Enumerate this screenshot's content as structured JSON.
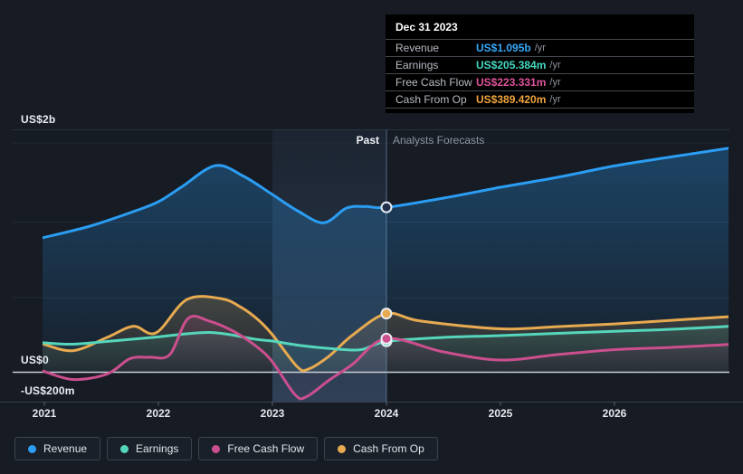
{
  "tooltip": {
    "title": "Dec 31 2023",
    "rows": [
      {
        "label": "Revenue",
        "value": "US$1.095b",
        "suffix": "/yr",
        "color": "#36a7f9"
      },
      {
        "label": "Earnings",
        "value": "US$205.384m",
        "suffix": "/yr",
        "color": "#45d9c2"
      },
      {
        "label": "Free Cash Flow",
        "value": "US$223.331m",
        "suffix": "/yr",
        "color": "#e0539d"
      },
      {
        "label": "Cash From Op",
        "value": "US$389.420m",
        "suffix": "/yr",
        "color": "#efa43d"
      }
    ]
  },
  "annotations": {
    "past": "Past",
    "forecast": "Analysts Forecasts"
  },
  "axes": {
    "y_labels": {
      "top": "US$2b",
      "zero": "US$0",
      "neg": "-US$200m"
    },
    "x_ticks": [
      "2021",
      "2022",
      "2023",
      "2024",
      "2025",
      "2026"
    ]
  },
  "legend": {
    "items": [
      {
        "label": "Revenue",
        "color": "#2b9df2"
      },
      {
        "label": "Earnings",
        "color": "#55d6bb"
      },
      {
        "label": "Free Cash Flow",
        "color": "#cb4f8e"
      },
      {
        "label": "Cash From Op",
        "color": "#e7aa50"
      }
    ]
  },
  "chart_data": {
    "type": "area",
    "title": "Past performance and analysts forecasts",
    "unit": "US$ millions per year",
    "x_domain": [
      2021,
      2027
    ],
    "x_tick_years": [
      2021,
      2022,
      2023,
      2024,
      2025,
      2026
    ],
    "y_axis": {
      "top_label": "US$2b",
      "zero_label": "US$0",
      "neg_label": "-US$200m",
      "gridline_step_musd": 500
    },
    "past_band_years": [
      2023,
      2024
    ],
    "divider_year": 2024,
    "legend_position": "bottom",
    "series": [
      {
        "name": "Revenue",
        "color": "#2b9df2",
        "points": [
          [
            2020.98,
            892
          ],
          [
            2021.4,
            970
          ],
          [
            2021.8,
            1072
          ],
          [
            2022.0,
            1132
          ],
          [
            2022.2,
            1228
          ],
          [
            2022.5,
            1372
          ],
          [
            2022.75,
            1300
          ],
          [
            2023.0,
            1180
          ],
          [
            2023.22,
            1072
          ],
          [
            2023.45,
            992
          ],
          [
            2023.65,
            1090
          ],
          [
            2023.82,
            1100
          ],
          [
            2024.0,
            1095
          ],
          [
            2024.5,
            1156
          ],
          [
            2025.0,
            1228
          ],
          [
            2025.5,
            1294
          ],
          [
            2026.0,
            1370
          ],
          [
            2026.5,
            1430
          ],
          [
            2027.0,
            1487
          ]
        ]
      },
      {
        "name": "Cash From Op",
        "color": "#e7aa50",
        "points": [
          [
            2020.98,
            190
          ],
          [
            2021.25,
            143
          ],
          [
            2021.55,
            231
          ],
          [
            2021.78,
            305
          ],
          [
            2021.98,
            262
          ],
          [
            2022.25,
            483
          ],
          [
            2022.55,
            489
          ],
          [
            2022.73,
            429
          ],
          [
            2022.88,
            345
          ],
          [
            2023.0,
            249
          ],
          [
            2023.22,
            35
          ],
          [
            2023.32,
            22
          ],
          [
            2023.5,
            109
          ],
          [
            2023.7,
            245
          ],
          [
            2024.0,
            389
          ],
          [
            2024.3,
            340
          ],
          [
            2025.0,
            288
          ],
          [
            2025.5,
            303
          ],
          [
            2026.0,
            321
          ],
          [
            2026.5,
            345
          ],
          [
            2027.0,
            369
          ]
        ]
      },
      {
        "name": "Earnings",
        "color": "#55d6bb",
        "points": [
          [
            2020.98,
            196
          ],
          [
            2021.25,
            186
          ],
          [
            2021.6,
            208
          ],
          [
            2021.95,
            231
          ],
          [
            2022.45,
            264
          ],
          [
            2022.85,
            219
          ],
          [
            2023.0,
            207
          ],
          [
            2023.25,
            177
          ],
          [
            2023.55,
            155
          ],
          [
            2023.78,
            150
          ],
          [
            2024.0,
            205
          ],
          [
            2024.5,
            231
          ],
          [
            2025.0,
            243
          ],
          [
            2025.5,
            258
          ],
          [
            2026.0,
            272
          ],
          [
            2026.5,
            285
          ],
          [
            2027.0,
            305
          ]
        ]
      },
      {
        "name": "Free Cash Flow",
        "color": "#cb4f8e",
        "points": [
          [
            2020.98,
            10
          ],
          [
            2021.25,
            -48
          ],
          [
            2021.55,
            -12
          ],
          [
            2021.75,
            90
          ],
          [
            2021.92,
            100
          ],
          [
            2022.1,
            117
          ],
          [
            2022.26,
            357
          ],
          [
            2022.45,
            339
          ],
          [
            2022.67,
            267
          ],
          [
            2022.86,
            171
          ],
          [
            2023.0,
            69
          ],
          [
            2023.2,
            -150
          ],
          [
            2023.3,
            -162
          ],
          [
            2023.5,
            -51
          ],
          [
            2023.7,
            51
          ],
          [
            2024.0,
            223
          ],
          [
            2024.5,
            135
          ],
          [
            2025.0,
            81
          ],
          [
            2025.5,
            117
          ],
          [
            2026.0,
            150
          ],
          [
            2026.5,
            165
          ],
          [
            2027.0,
            185
          ]
        ]
      }
    ],
    "markers": {
      "year": 2024,
      "values": [
        {
          "series": "Revenue",
          "value": 1095,
          "hollow": true
        },
        {
          "series": "Cash From Op",
          "value": 389.42,
          "hollow": false
        },
        {
          "series": "Earnings",
          "value": 205.384,
          "hollow": false
        },
        {
          "series": "Free Cash Flow",
          "value": 223.331,
          "hollow": false
        }
      ]
    }
  }
}
